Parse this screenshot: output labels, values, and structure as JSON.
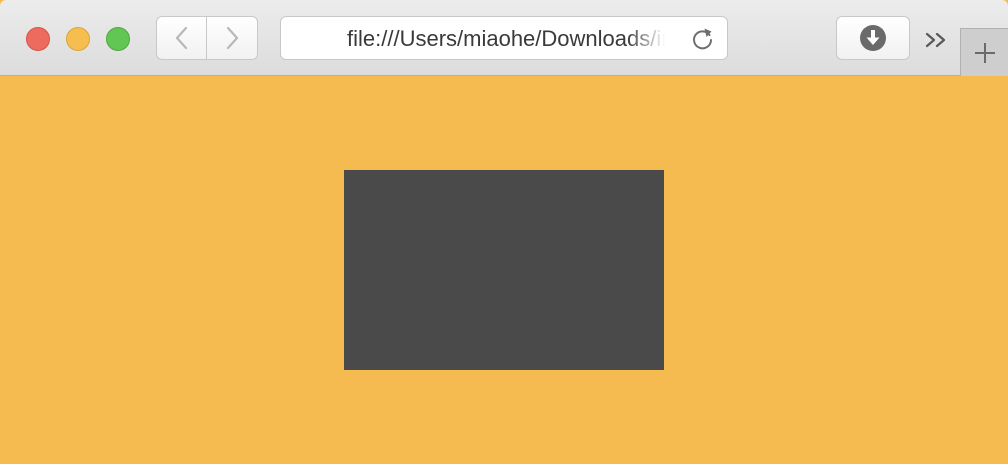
{
  "address_bar": {
    "url": "file:///Users/miaohe/Downloads/index.html"
  },
  "icons": {
    "close": "close-traffic-light-icon",
    "minimize": "minimize-traffic-light-icon",
    "zoom": "zoom-traffic-light-icon",
    "back": "chevron-left-icon",
    "forward": "chevron-right-icon",
    "reload": "reload-icon",
    "download": "download-icon",
    "overflow": "double-chevron-right-icon",
    "new_tab": "plus-icon"
  },
  "colors": {
    "page_background": "#f5bb51",
    "box": "#4a4a4a",
    "traffic_close": "#ed6a5e",
    "traffic_minimize": "#f5be4f",
    "traffic_zoom": "#62c655"
  }
}
